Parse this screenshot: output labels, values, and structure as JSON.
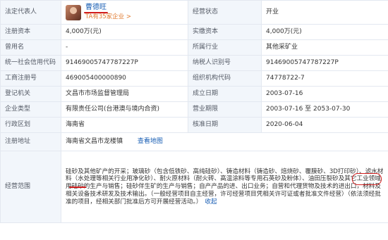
{
  "rows": {
    "legal_rep": {
      "label": "法定代表人",
      "name": "曹德旺",
      "sub": "TA有35家企业 >",
      "status_label": "经营状态",
      "status_value": "开业"
    },
    "capital": {
      "label": "注册资本",
      "value": "4,000万(元)",
      "paid_label": "实缴资本",
      "paid_value": "4,000万(元)"
    },
    "former": {
      "label": "曾用名",
      "value": "-",
      "industry_label": "所属行业",
      "industry_value": "其他采矿业"
    },
    "credit": {
      "label": "统一社会信用代码",
      "value": "91469005747787227P",
      "tax_label": "纳税人识别号",
      "tax_value": "91469005747787227P"
    },
    "reg_no": {
      "label": "工商注册号",
      "value": "469005400000890",
      "org_label": "组织机构代码",
      "org_value": "74778722-7"
    },
    "authority": {
      "label": "登记机关",
      "value": "文昌市市场监督管理局",
      "found_label": "成立日期",
      "found_value": "2003-07-16"
    },
    "type": {
      "label": "企业类型",
      "value": "有限责任公司(台港澳与境内合资)",
      "term_label": "营业期限",
      "term_value": "2003-07-16 至 2053-07-30"
    },
    "region": {
      "label": "行政区划",
      "value": "海南省",
      "approve_label": "核准日期",
      "approve_value": "2020-06-04"
    },
    "address": {
      "label": "注册地址",
      "value": "海南省文昌市龙楼镇",
      "map_link": "查看地图"
    },
    "scope": {
      "label": "经营范围",
      "text": "硅砂及其他矿产的开采；玻璃砂（包含低铁砂、高纯硅砂）、铸造材料（铸造砂、焙烧砂、覆膜砂、3D打印砂）、滤水材料（水处理等相关行业用净化砂）、耐火原材料（耐火砖、高温涂料等专用石英砂及粉体）、油田压裂砂及其它工业领域用硅砂的生产与销售；硅砂伴生矿的生产与销售；自产产品的进、出口业务；自营和代理货物及技术的进出口，材料及相关设备技术研发及技术输出。（一般经营项目自主经营，许可经营项目凭相关许可证或者批准文件经营）（依法须经批准的项目，经相关部门批准后方可开展经营活动。）",
      "fold_link": "收起"
    }
  },
  "colors": {
    "label_bg": "#f2f6fb",
    "border": "#e3e8f0",
    "link": "#1a5fb4",
    "highlight": "#d11d1d",
    "sub_orange": "#e07a2e"
  }
}
